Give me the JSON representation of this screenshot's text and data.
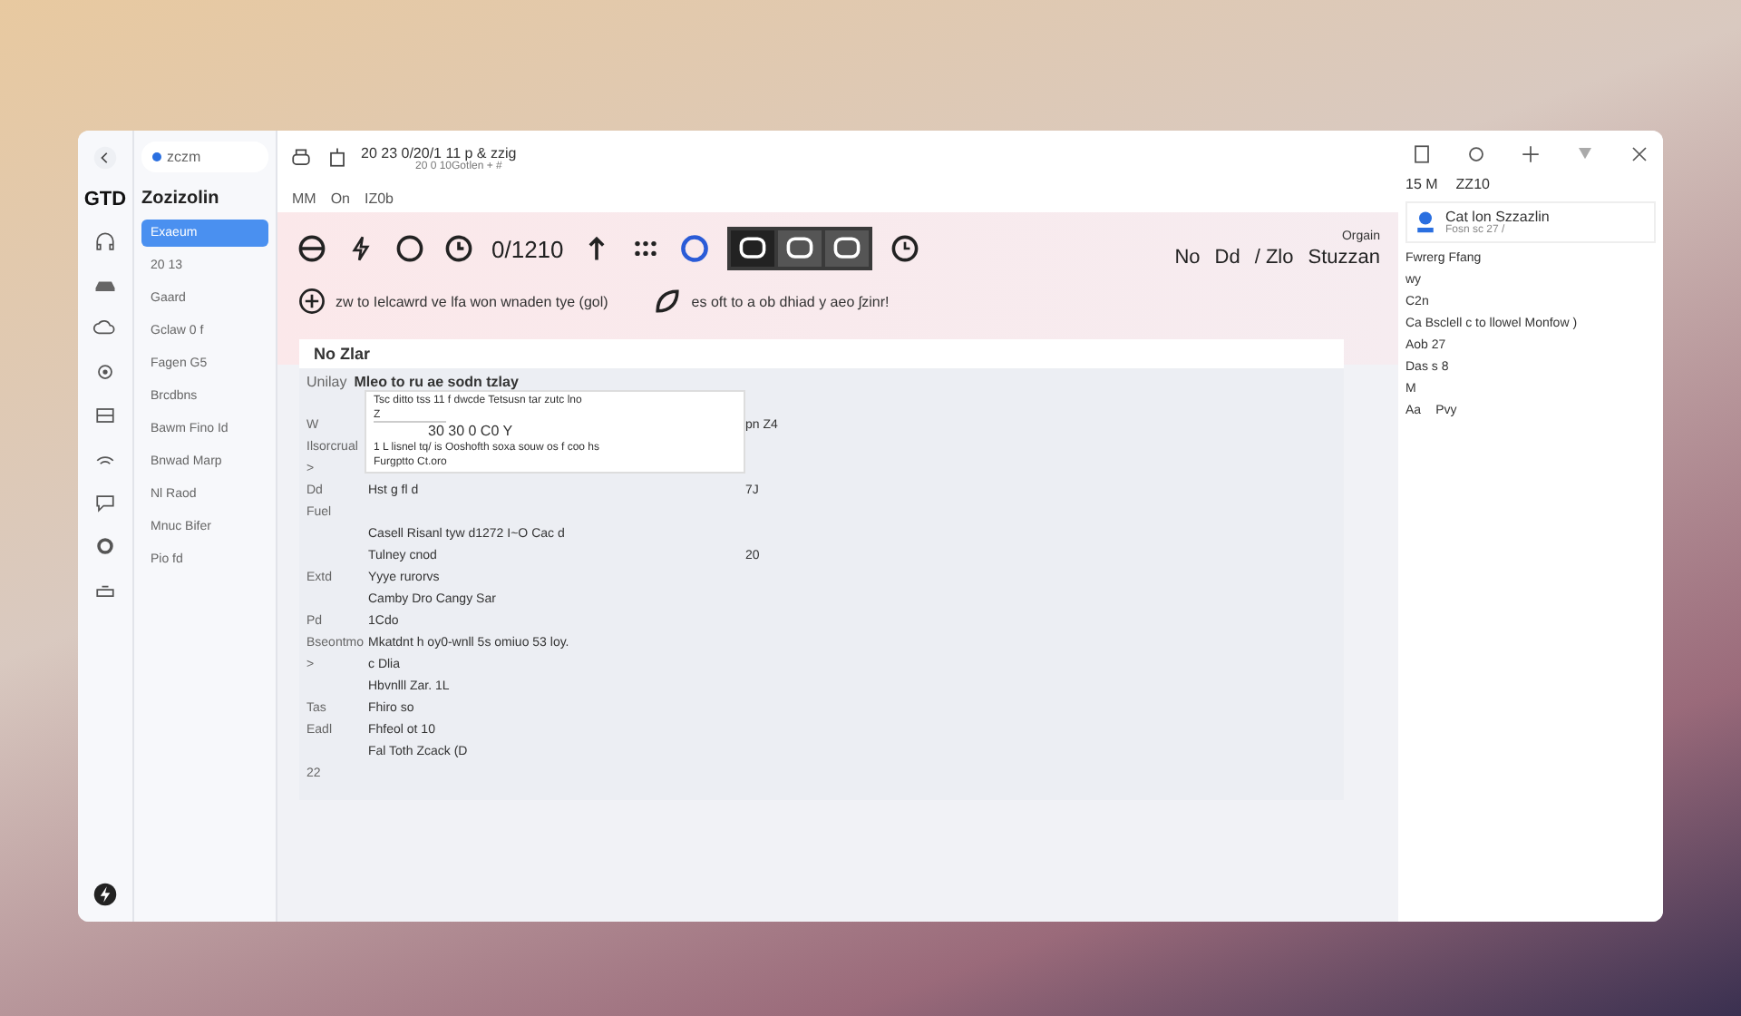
{
  "window": {
    "tab_title": "zczm",
    "title": "20 23 0/20/1 11 p & zzig",
    "subtitle": "20 0 10Gotlen + #"
  },
  "breadcrumbs": [
    "MM",
    "On",
    "IZ0b"
  ],
  "rail": {
    "logo": "GTD"
  },
  "sidebar": {
    "title": "Zozizolin",
    "items": [
      {
        "label": "Exaeum",
        "selected": true
      },
      {
        "label": "20 13",
        "selected": false
      },
      {
        "label": "Gaard",
        "selected": false
      },
      {
        "label": "Gclaw 0 f",
        "selected": false
      },
      {
        "label": "Fagen G5",
        "selected": false
      },
      {
        "label": "Brcdbns",
        "selected": false
      },
      {
        "label": "Bawm Fino Id",
        "selected": false
      },
      {
        "label": "Bnwad Marp",
        "selected": false
      },
      {
        "label": "Nl Raod",
        "selected": false
      },
      {
        "label": "Mnuc Bifer",
        "selected": false
      },
      {
        "label": "Pio fd",
        "selected": false
      }
    ]
  },
  "toolbar": {
    "counter": "0/1210",
    "toggles": [
      {
        "selected": true
      },
      {
        "selected": false
      },
      {
        "selected": false
      }
    ],
    "org": "Orgain",
    "links": [
      "No",
      "Dd",
      "/ Zlo",
      "Stuzzan"
    ]
  },
  "notices": [
    "zw to Ielcawrd ve lfa won wnaden tye (gol)",
    "es oft to a ob dhiad y aeo ʃzinr!"
  ],
  "panel": {
    "title": "No Zlar",
    "sub_label": "Unilay",
    "sub_title": "Mleo to ru ae sodn tzlay",
    "rows": [
      {
        "label": "W",
        "text": "",
        "value": "pn Z4"
      },
      {
        "label": "Ilsorcrual",
        "text": "",
        "value": ""
      },
      {
        "label": ">",
        "text": "",
        "value": ""
      },
      {
        "label": "Dd",
        "text": "Hst g fl d",
        "value": "7J"
      },
      {
        "label": "Fuel",
        "text": "",
        "value": ""
      },
      {
        "label": "",
        "text": "Casell Risanl tyw d1272 I~O Cac d",
        "value": ""
      },
      {
        "label": "",
        "text": "Tulney cnod",
        "value": "20"
      },
      {
        "label": "Extd",
        "text": "Yyye rurorvs",
        "value": ""
      },
      {
        "label": "",
        "text": "Camby Dro Cangy Sar",
        "value": ""
      },
      {
        "label": "Pd",
        "text": "1Cdo",
        "value": ""
      },
      {
        "label": "Bseontmo",
        "text": "Mkatdnt h oy0-wnll 5s omiuo 53 loy.",
        "value": ""
      },
      {
        "label": ">",
        "text": "c Dlia",
        "value": ""
      },
      {
        "label": "",
        "text": "Hbvnlll Zar. 1L",
        "value": ""
      },
      {
        "label": "Tas",
        "text": "Fhiro so",
        "value": ""
      },
      {
        "label": "Eadl",
        "text": "Fhfeol ot 10",
        "value": ""
      },
      {
        "label": "",
        "text": "Fal Toth Zcack (D",
        "value": ""
      },
      {
        "label": "22",
        "text": "",
        "value": ""
      }
    ],
    "popup": {
      "hint": "Tsc ditto tss 11 f dwcde Tetsusn tar zutc lno",
      "field": "Z",
      "heading": "30 30 0 C0 Y",
      "line": "1 L lisnel tq/ is Ooshofth soxa souw os f coo hs",
      "foot": "Furgptto Ct.oro"
    }
  },
  "right": {
    "header": "15 M",
    "header_value": "ZZ10",
    "card_title": "Cat lon Szzazlin",
    "card_sub": "Fosn sc 27 /",
    "item": "Fwrerg Ffang",
    "entries": [
      "wy",
      "C2n"
    ],
    "section": "Ca Bsclell c to llowel Monfow )",
    "people": [
      "Aob 27",
      "Das s 8",
      "M"
    ],
    "foot_label": "Aa",
    "foot_value": "Pvy"
  }
}
